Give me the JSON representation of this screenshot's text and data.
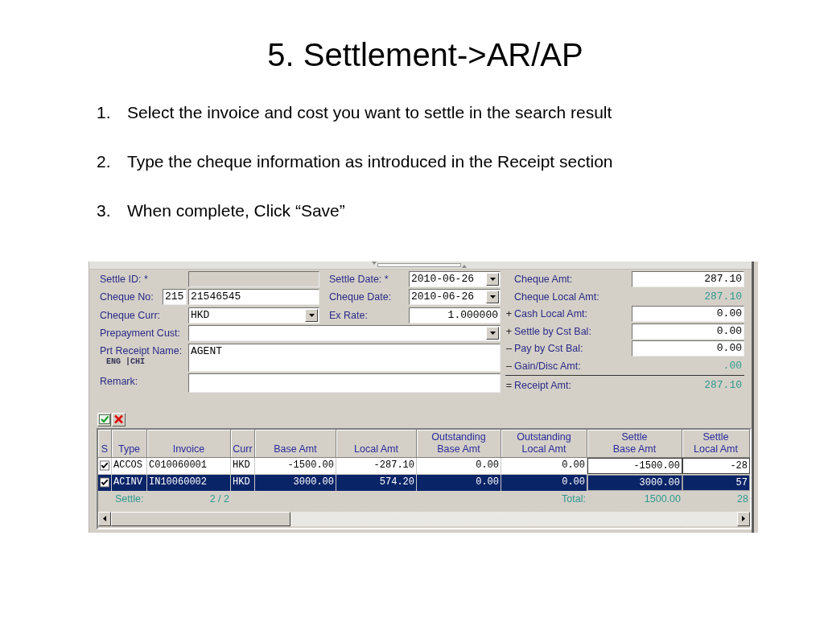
{
  "slide": {
    "title": "5. Settlement->AR/AP",
    "steps": [
      {
        "number": "1.",
        "text": "Select the invoice and cost you want to settle in the search result"
      },
      {
        "number": "2.",
        "text": "Type the cheque information as introduced in the Receipt section"
      },
      {
        "number": "3.",
        "text": "When complete, Click “Save”"
      }
    ]
  },
  "form": {
    "rows": [
      {
        "fields": [
          {
            "label": "Settle ID: *",
            "kind": "readonly"
          },
          {
            "label": "Settle Date: *",
            "kind": "dropdown",
            "value": "2010-06-26"
          }
        ]
      },
      {
        "fields": [
          {
            "label": "Cheque No:",
            "kind": "prefixed",
            "prefix": "215",
            "value": "21546545"
          },
          {
            "label": "Cheque Date:",
            "kind": "dropdown",
            "value": "2010-06-26"
          }
        ]
      },
      {
        "fields": [
          {
            "label": "Cheque Curr:",
            "kind": "dropdown",
            "value": "HKD"
          },
          {
            "label": "Ex Rate:",
            "kind": "number",
            "value": "1.000000"
          }
        ]
      },
      {
        "fields": [
          {
            "label": "Prepayment Cust:",
            "kind": "dropdown"
          }
        ]
      },
      {
        "fields": [
          {
            "label": "Prt Receipt Name:",
            "kind": "textarea",
            "value": "AGENT",
            "language_toggle": "ENG |CHI"
          }
        ]
      },
      {
        "fields": [
          {
            "label": "Remark:",
            "kind": "text"
          }
        ]
      }
    ],
    "amounts": [
      {
        "label": "Cheque Amt:",
        "kind": "input",
        "value": "287.10"
      },
      {
        "label": "Cheque Local Amt:",
        "kind": "display",
        "value": "287.10"
      },
      {
        "sign": "+",
        "label": "Cash Local Amt:",
        "kind": "input",
        "value": "0.00"
      },
      {
        "sign": "+",
        "label": "Settle by Cst Bal:",
        "kind": "input",
        "value": "0.00"
      },
      {
        "sign": "–",
        "label": "Pay by Cst Bal:",
        "kind": "input",
        "value": "0.00"
      },
      {
        "sign": "–",
        "label": "Gain/Disc Amt:",
        "kind": "display",
        "value": ".00"
      },
      {
        "sign": "=",
        "label": "Receipt Amt:",
        "kind": "total",
        "value": "287.10"
      }
    ]
  },
  "table": {
    "select_column": {
      "label": "S"
    },
    "columns": [
      {
        "label": "Type",
        "kind": "text"
      },
      {
        "label": "Invoice",
        "kind": "text"
      },
      {
        "label": "Curr",
        "kind": "text"
      },
      {
        "label": "Base Amt",
        "kind": "number"
      },
      {
        "label": "Local Amt",
        "kind": "number"
      },
      {
        "label": "Outstanding\nBase Amt",
        "kind": "number"
      },
      {
        "label": "Outstanding\nLocal Amt",
        "kind": "number"
      },
      {
        "label": "Settle\nBase Amt",
        "kind": "input"
      },
      {
        "label": "Settle\nLocal Amt",
        "kind": "input"
      }
    ],
    "rows": [
      {
        "selected": false,
        "checked": true,
        "cells": [
          "ACCOS",
          "C010060001",
          "HKD",
          "-1500.00",
          "-287.10",
          "0.00",
          "0.00",
          "-1500.00",
          "-28"
        ]
      },
      {
        "selected": true,
        "checked": true,
        "cells": [
          "ACINV",
          "IN10060002",
          "HKD",
          "3000.00",
          "574.20",
          "0.00",
          "0.00",
          "3000.00",
          "57"
        ]
      }
    ],
    "summary": {
      "settle_label": "Settle:",
      "settle_count": "2 / 2",
      "total_label": "Total:",
      "totals": [
        "1500.00",
        "28"
      ]
    }
  }
}
